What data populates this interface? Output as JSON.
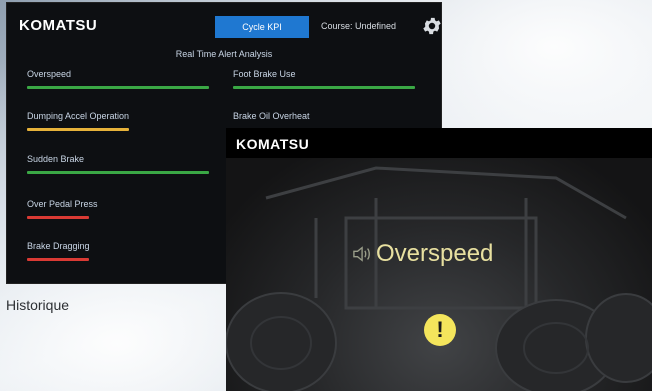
{
  "dashboard": {
    "logo": "KOMATSU",
    "kpi_button": "Cycle KPI",
    "course": "Course: Undefined",
    "icons": {
      "settings": "gear-icon"
    },
    "title": "Real Time Alert Analysis",
    "alerts": [
      {
        "label": "Overspeed",
        "status_color": "#3aa845"
      },
      {
        "label": "Foot Brake Use",
        "status_color": "#3aa845"
      },
      {
        "label": "Dumping Accel Operation",
        "status_color": "#e6b23a"
      },
      {
        "label": "Brake Oil Overheat",
        "status_color": "#e6b23a"
      },
      {
        "label": "Sudden Brake",
        "status_color": "#3aa845"
      },
      {
        "label": "Over Pedal Press",
        "status_color": "#d93a34"
      },
      {
        "label": "Brake Dragging",
        "status_color": "#d93a34"
      }
    ]
  },
  "alert_screen": {
    "logo": "KOMATSU",
    "message": "Overspeed",
    "icons": {
      "sound": "speaker-icon",
      "warning": "exclamation-icon"
    },
    "accent_color": "#f4e55c"
  },
  "caption": "Historique"
}
